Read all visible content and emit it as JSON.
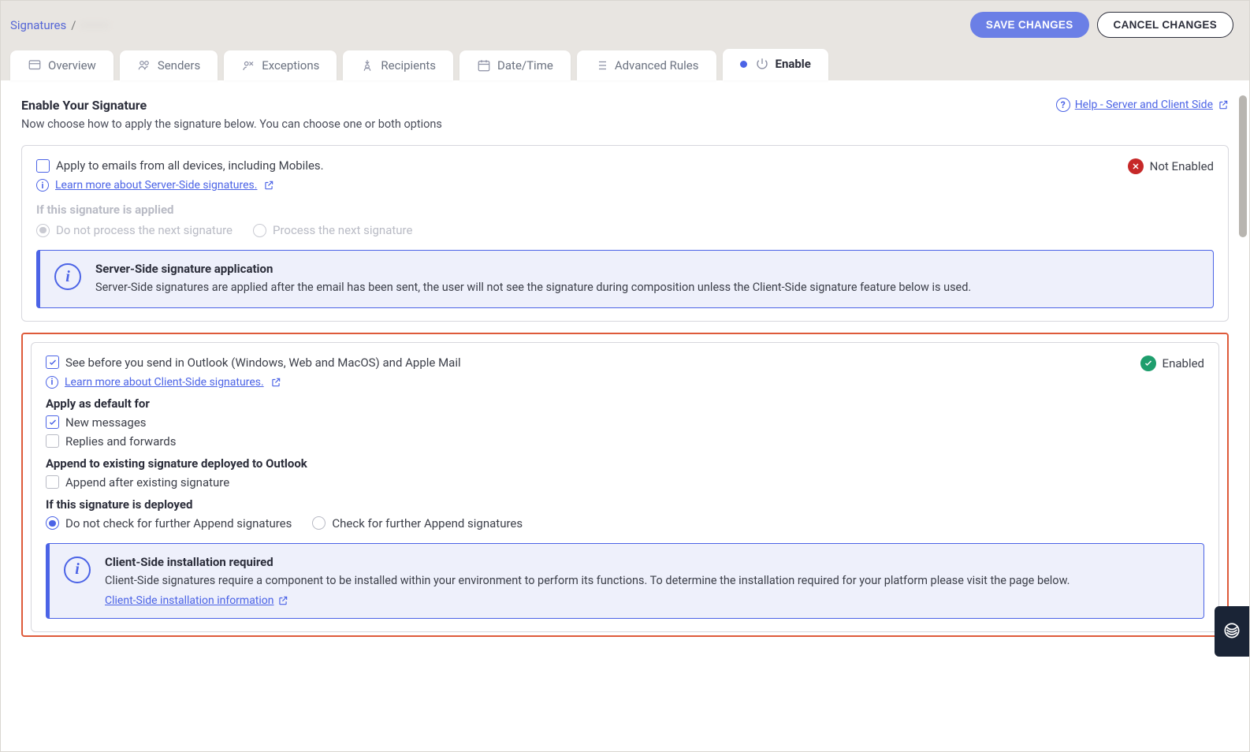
{
  "breadcrumb": {
    "root": "Signatures",
    "sep": "/",
    "leaf": " "
  },
  "actions": {
    "save": "SAVE CHANGES",
    "cancel": "CANCEL CHANGES"
  },
  "tabs": [
    {
      "label": "Overview",
      "icon": "overview"
    },
    {
      "label": "Senders",
      "icon": "senders"
    },
    {
      "label": "Exceptions",
      "icon": "exceptions"
    },
    {
      "label": "Recipients",
      "icon": "recipients"
    },
    {
      "label": "Date/Time",
      "icon": "datetime"
    },
    {
      "label": "Advanced Rules",
      "icon": "adv"
    },
    {
      "label": "Enable",
      "icon": "power",
      "active": true
    }
  ],
  "heading": {
    "title": "Enable Your Signature",
    "subtitle": "Now choose how to apply the signature below. You can choose one or both options"
  },
  "help": {
    "label": "Help - Server and Client Side"
  },
  "server_panel": {
    "checkbox_label": "Apply to emails from all devices, including Mobiles.",
    "learn_more": "Learn more about Server-Side signatures.",
    "status": "Not Enabled",
    "applied_label": "If this signature is applied",
    "radios": {
      "a": "Do not process the next signature",
      "b": "Process the next signature"
    },
    "callout_title": "Server-Side signature application",
    "callout_body": "Server-Side signatures are applied after the email has been sent, the user will not see the signature during composition unless the Client-Side signature feature below is used."
  },
  "client_panel": {
    "checkbox_label": "See before you send in Outlook (Windows, Web and MacOS) and Apple Mail",
    "learn_more": "Learn more about Client-Side signatures.",
    "status": "Enabled",
    "apply_default_label": "Apply as default for",
    "new_messages": "New messages",
    "replies_forwards": "Replies and forwards",
    "append_label": "Append to existing signature deployed to Outlook",
    "append_after": "Append after existing signature",
    "deployed_label": "If this signature is deployed",
    "radio_a": "Do not check for further Append signatures",
    "radio_b": "Check for further Append signatures",
    "callout_title": "Client-Side installation required",
    "callout_body": "Client-Side signatures require a component to be installed within your environment to perform its functions. To determine the installation required for your platform please visit the page below.",
    "callout_link": "Client-Side installation information"
  }
}
